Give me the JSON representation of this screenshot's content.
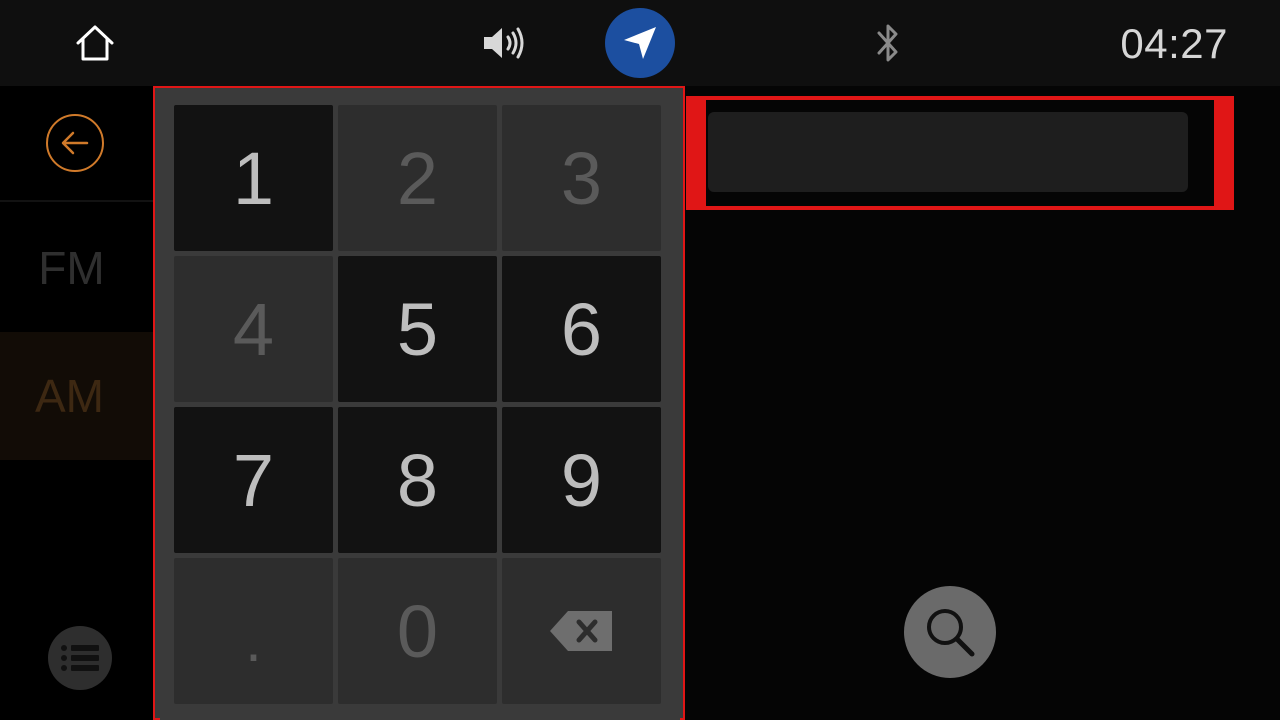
{
  "status_bar": {
    "time": "04:27",
    "icons": {
      "home": "home-icon",
      "volume": "volume-icon",
      "navigation": "navigation-arrow-icon",
      "bluetooth": "bluetooth-icon"
    },
    "nav_color": "#1c4fa0"
  },
  "sidebar": {
    "back_icon": "back-arrow-icon",
    "bands": [
      {
        "label": "FM",
        "selected": false
      },
      {
        "label": "AM",
        "selected": true
      }
    ],
    "list_icon": "list-icon",
    "accent_color": "#d07a2a"
  },
  "keypad": {
    "keys": [
      {
        "label": "1",
        "enabled": true
      },
      {
        "label": "2",
        "enabled": false
      },
      {
        "label": "3",
        "enabled": false
      },
      {
        "label": "4",
        "enabled": false
      },
      {
        "label": "5",
        "enabled": true
      },
      {
        "label": "6",
        "enabled": true
      },
      {
        "label": "7",
        "enabled": true
      },
      {
        "label": "8",
        "enabled": true
      },
      {
        "label": "9",
        "enabled": true
      },
      {
        "label": ".",
        "enabled": false
      },
      {
        "label": "0",
        "enabled": false
      },
      {
        "label": "",
        "icon": "backspace-icon",
        "enabled": true
      }
    ],
    "highlight_color": "#e01616"
  },
  "frequency_input": {
    "value": "",
    "placeholder": ""
  },
  "search": {
    "icon": "search-icon"
  }
}
